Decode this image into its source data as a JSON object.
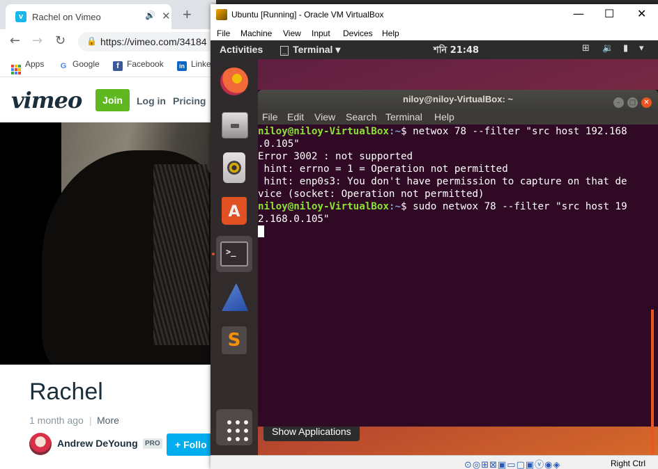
{
  "browser": {
    "tab_title": "Rachel on Vimeo",
    "tab_favicon": "v",
    "close_tab": "✕",
    "new_tab": "+",
    "url": "https://vimeo.com/34184",
    "bookmarks": [
      "Apps",
      "Google",
      "Facebook",
      "Linke"
    ]
  },
  "vimeo": {
    "logo": "vimeo",
    "join": "Join",
    "login": "Log in",
    "pricing": "Pricing",
    "video_title": "Rachel",
    "age": "1 month ago",
    "more": "More",
    "author": "Andrew DeYoung",
    "pro_badge": "PRO",
    "follow": "+ Follo"
  },
  "vbox": {
    "title": "Ubuntu [Running] - Oracle VM VirtualBox",
    "menu": [
      "File",
      "Machine",
      "View",
      "Input",
      "Devices",
      "Help"
    ],
    "host_key": "Right Ctrl",
    "status_icons": "⊙◎⊞⊠▣▭▢▣ⓥ◉◈"
  },
  "ubuntu": {
    "activities": "Activities",
    "app_menu": "Terminal ▾",
    "clock": "শনি 21:48",
    "tooltip": "Show Applications"
  },
  "terminal": {
    "title": "niloy@niloy-VirtualBox: ~",
    "menu": [
      "File",
      "Edit",
      "View",
      "Search",
      "Terminal",
      "Help"
    ],
    "prompt_user": "niloy@niloy-VirtualBox",
    "prompt_path": ":~",
    "prompt_sign": "$ ",
    "cmd1_a": "netwox 78 --filter \"src host 192.168",
    "cmd1_b": ".0.105\"",
    "out1": "Error 3002 : not supported",
    "out2": " hint: errno = 1 = Operation not permitted",
    "out3": " hint: enp0s3: You don't have permission to capture on that de",
    "out4": "vice (socket: Operation not permitted)",
    "cmd2_a": "sudo netwox 78 --filter \"src host 19",
    "cmd2_b": "2.168.0.105\""
  },
  "colors": {
    "terminal_bg": "#300a24",
    "prompt_user": "#8ae234",
    "prompt_path": "#729fcf",
    "ubuntu_orange": "#e95420",
    "vimeo_join": "#5fb820",
    "vimeo_follow": "#00adef"
  }
}
